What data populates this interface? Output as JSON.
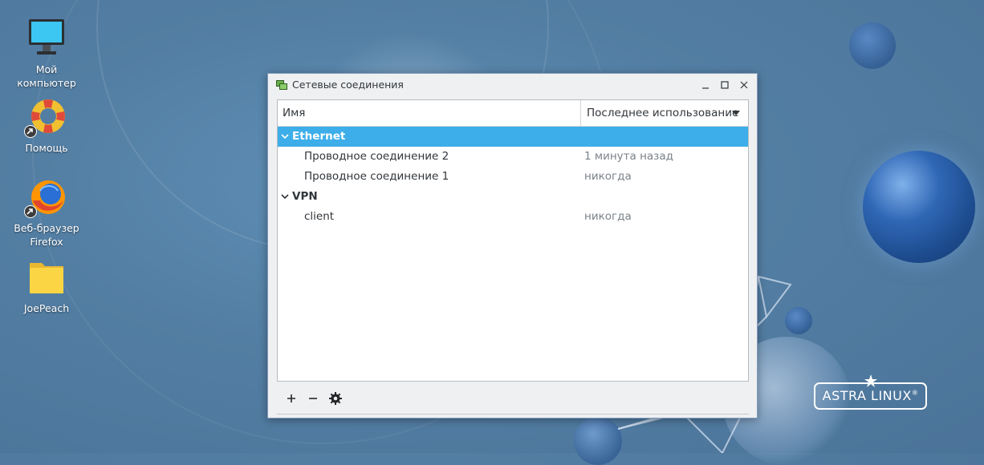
{
  "desktop": {
    "icons": [
      {
        "label_line1": "Мой",
        "label_line2": "компьютер",
        "icon": "monitor-icon"
      },
      {
        "label_line1": "Помощь",
        "label_line2": "",
        "icon": "lifebuoy-icon"
      },
      {
        "label_line1": "Веб-браузер",
        "label_line2": "Firefox",
        "icon": "firefox-icon"
      },
      {
        "label_line1": "JoePeach",
        "label_line2": "",
        "icon": "folder-icon"
      }
    ],
    "branding": {
      "text": "ASTRA LINUX",
      "registered": "®"
    }
  },
  "window": {
    "title": "Сетевые соединения",
    "columns": {
      "name": "Имя",
      "last_used": "Последнее использование"
    },
    "groups": [
      {
        "label": "Ethernet",
        "selected": true,
        "connections": [
          {
            "name": "Проводное соединение 2",
            "last_used": "1 минута назад"
          },
          {
            "name": "Проводное соединение 1",
            "last_used": "никогда"
          }
        ]
      },
      {
        "label": "VPN",
        "selected": false,
        "connections": [
          {
            "name": "client",
            "last_used": "никогда"
          }
        ]
      }
    ],
    "toolbar": {
      "add": "+",
      "remove": "−",
      "settings": "gear-icon"
    }
  },
  "colors": {
    "selection": "#3daee9",
    "window_bg": "#eff0f1",
    "desktop_bg": "#537ea3"
  }
}
